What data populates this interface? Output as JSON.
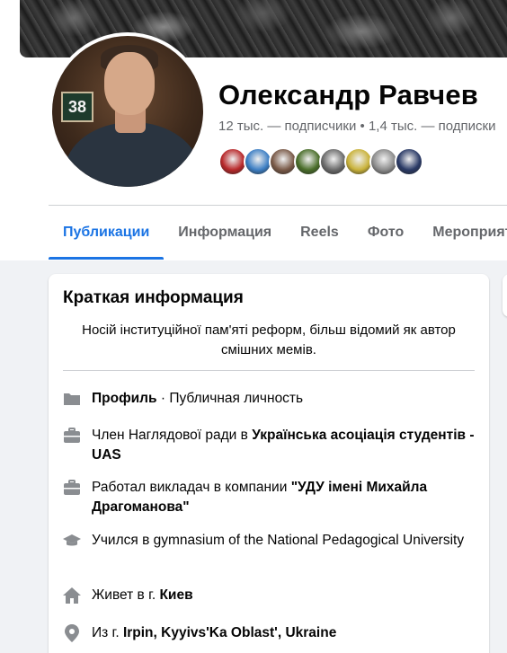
{
  "profile": {
    "name": "Олександр Равчев",
    "stats": "12 тыс. — подписчики • 1,4 тыс. — подписки",
    "avatar_sign": "38",
    "followers": [
      "#b8282a",
      "#3d7fc4",
      "#7a5a48",
      "#4a6e2a",
      "#6b6b6b",
      "#c9b23a",
      "#8c8c8c",
      "#2a3a66"
    ]
  },
  "tabs": [
    "Публикации",
    "Информация",
    "Reels",
    "Фото",
    "Мероприятия"
  ],
  "intro": {
    "title": "Краткая информация",
    "bio": "Носій інституційної пам'яті реформ, більш відомий як автор смішних мемів.",
    "rows": [
      {
        "icon": "page-icon",
        "bold1": "Профиль",
        "rest": " · Публичная личность"
      },
      {
        "icon": "briefcase-icon",
        "prefix": "Член Наглядової ради в ",
        "bold1": "Українська асоціація студентів - UAS"
      },
      {
        "icon": "briefcase-icon",
        "prefix": "Работал викладач в компании ",
        "bold1": "\"УДУ імені Михайла Драгоманова\""
      },
      {
        "icon": "graduation-cap-icon",
        "prefix": "Учился в gymnasium of the National Pedagogical University"
      },
      {
        "icon": "home-icon",
        "prefix": "Живет в г. ",
        "bold1": "Киев"
      },
      {
        "icon": "location-pin-icon",
        "prefix": "Из г. ",
        "bold1": "Irpin, Kyyivs'Ka Oblast', Ukraine"
      }
    ]
  }
}
